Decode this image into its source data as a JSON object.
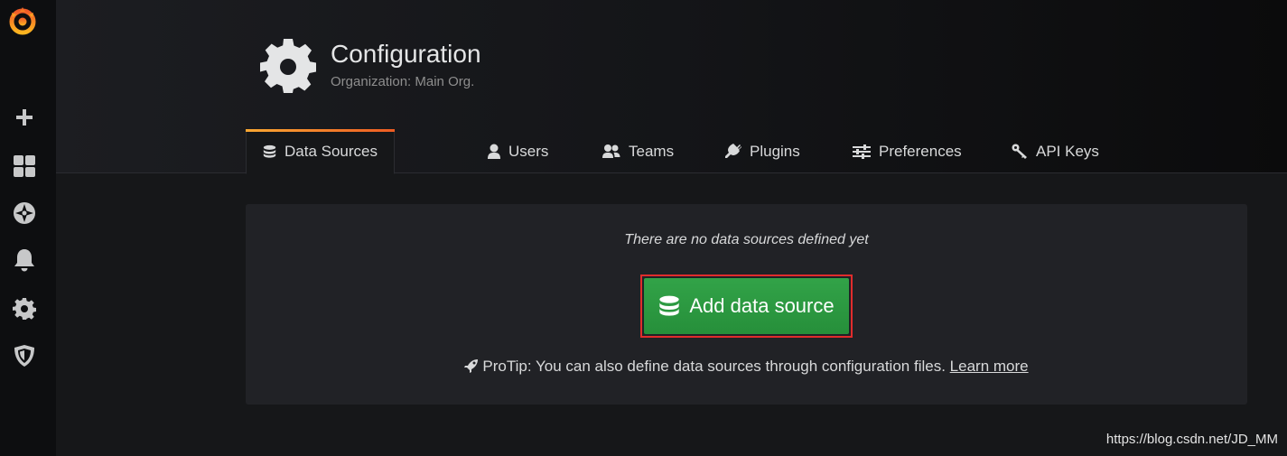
{
  "header": {
    "title": "Configuration",
    "subtitle": "Organization: Main Org."
  },
  "sidebar": {
    "items": [
      {
        "icon": "grafana-logo-icon"
      },
      {
        "icon": "plus-icon"
      },
      {
        "icon": "dashboards-icon"
      },
      {
        "icon": "explore-compass-icon"
      },
      {
        "icon": "alerting-bell-icon"
      },
      {
        "icon": "configuration-gear-icon"
      },
      {
        "icon": "server-admin-shield-icon"
      }
    ]
  },
  "tabs": [
    {
      "label": "Data Sources",
      "icon": "database-icon",
      "active": true
    },
    {
      "label": "Users",
      "icon": "user-icon",
      "active": false
    },
    {
      "label": "Teams",
      "icon": "users-icon",
      "active": false
    },
    {
      "label": "Plugins",
      "icon": "plug-icon",
      "active": false
    },
    {
      "label": "Preferences",
      "icon": "sliders-icon",
      "active": false
    },
    {
      "label": "API Keys",
      "icon": "key-icon",
      "active": false
    }
  ],
  "empty_state": {
    "message": "There are no data sources defined yet",
    "button_label": "Add data source",
    "protip_text": "ProTip: You can also define data sources through configuration files.",
    "learn_more_label": "Learn more"
  },
  "watermark": "https://blog.csdn.net/JD_MM",
  "colors": {
    "accent_orange": "#f9a732",
    "button_green": "#299c3f",
    "highlight_red": "#e02c2c"
  }
}
